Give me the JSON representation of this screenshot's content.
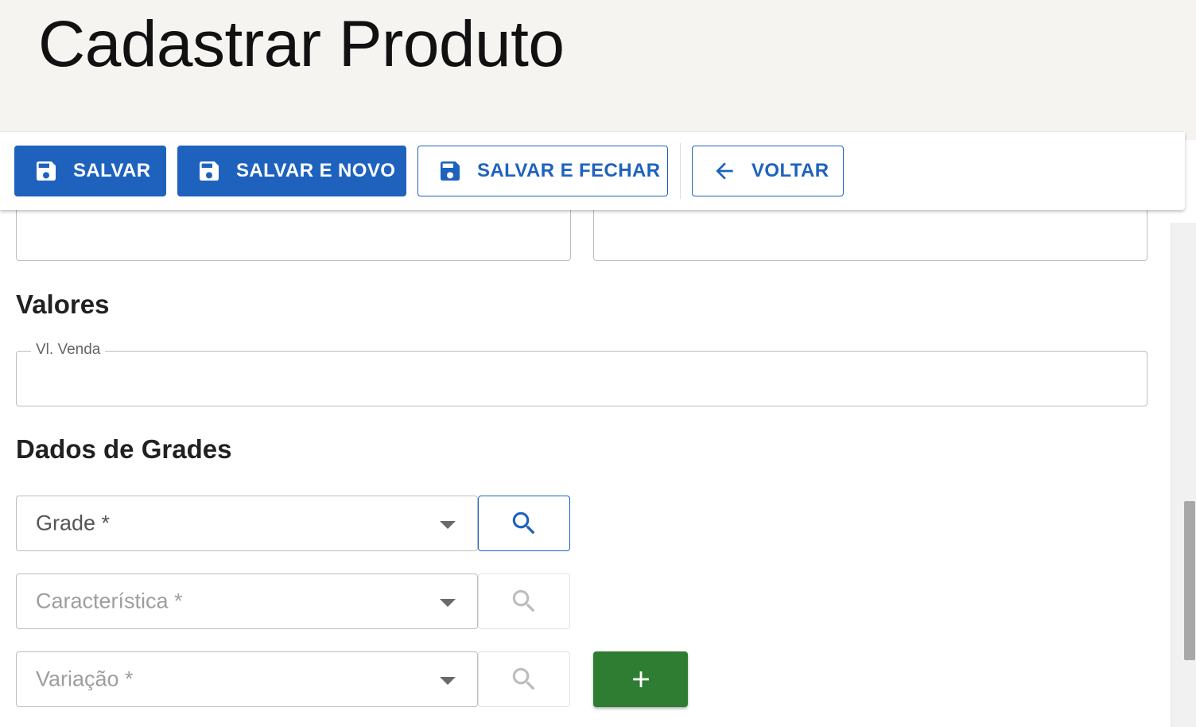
{
  "page": {
    "title": "Cadastrar Produto"
  },
  "toolbar": {
    "salvar_label": "SALVAR",
    "salvar_novo_label": "SALVAR E NOVO",
    "salvar_fechar_label": "SALVAR E FECHAR",
    "voltar_label": "VOLTAR"
  },
  "sections": {
    "valores_title": "Valores",
    "grades_title": "Dados de Grades"
  },
  "fields": {
    "vl_venda_label": "Vl. Venda",
    "vl_venda_value": "",
    "grade_label": "Grade *",
    "caracteristica_label": "Característica *",
    "variacao_label": "Variação *"
  },
  "colors": {
    "primary": "#1e62be",
    "success": "#2e7d32",
    "header_bg": "#f5f4f1"
  },
  "icons": {
    "save": "save-icon",
    "back": "arrow-left-icon",
    "search": "search-icon",
    "add": "plus-icon",
    "dropdown": "caret-down-icon"
  }
}
